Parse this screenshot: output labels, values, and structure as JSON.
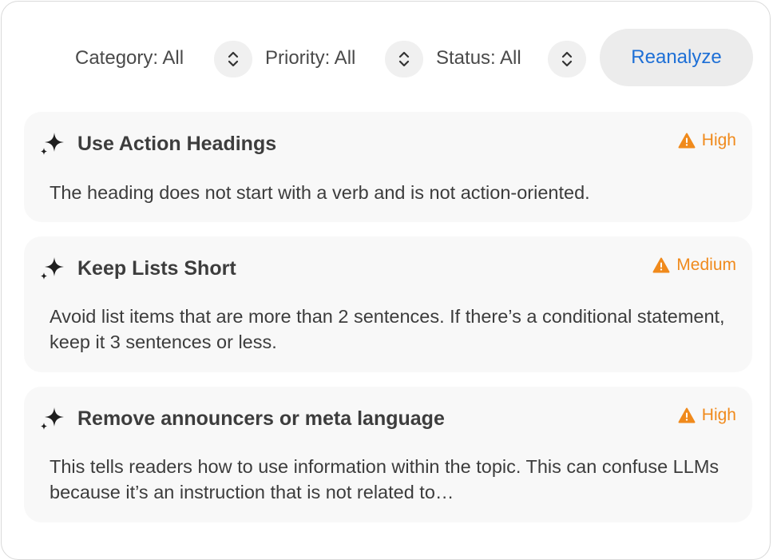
{
  "filters": {
    "category_label": "Category: All",
    "priority_label": "Priority: All",
    "status_label": "Status: All"
  },
  "actions": {
    "reanalyze_label": "Reanalyze"
  },
  "icons": {
    "sparkle": "sparkle-icon",
    "stepper": "chevron-up-down-icon",
    "warning": "warning-triangle-icon"
  },
  "colors": {
    "accent_blue": "#1d6fd6",
    "priority_orange": "#f08a1c",
    "card_bg": "#f8f8f8"
  },
  "suggestions": [
    {
      "title": "Use Action Headings",
      "priority": "High",
      "description": "The heading does not start with a verb and is not action-oriented."
    },
    {
      "title": "Keep Lists Short",
      "priority": "Medium",
      "description": "Avoid list items that are more than 2 sentences. If there’s a conditional statement, keep it 3 sentences or less."
    },
    {
      "title": "Remove announcers or meta language",
      "priority": "High",
      "description": "This tells readers how to use information within the topic. This can confuse LLMs because it’s an instruction that is not related to…"
    }
  ]
}
